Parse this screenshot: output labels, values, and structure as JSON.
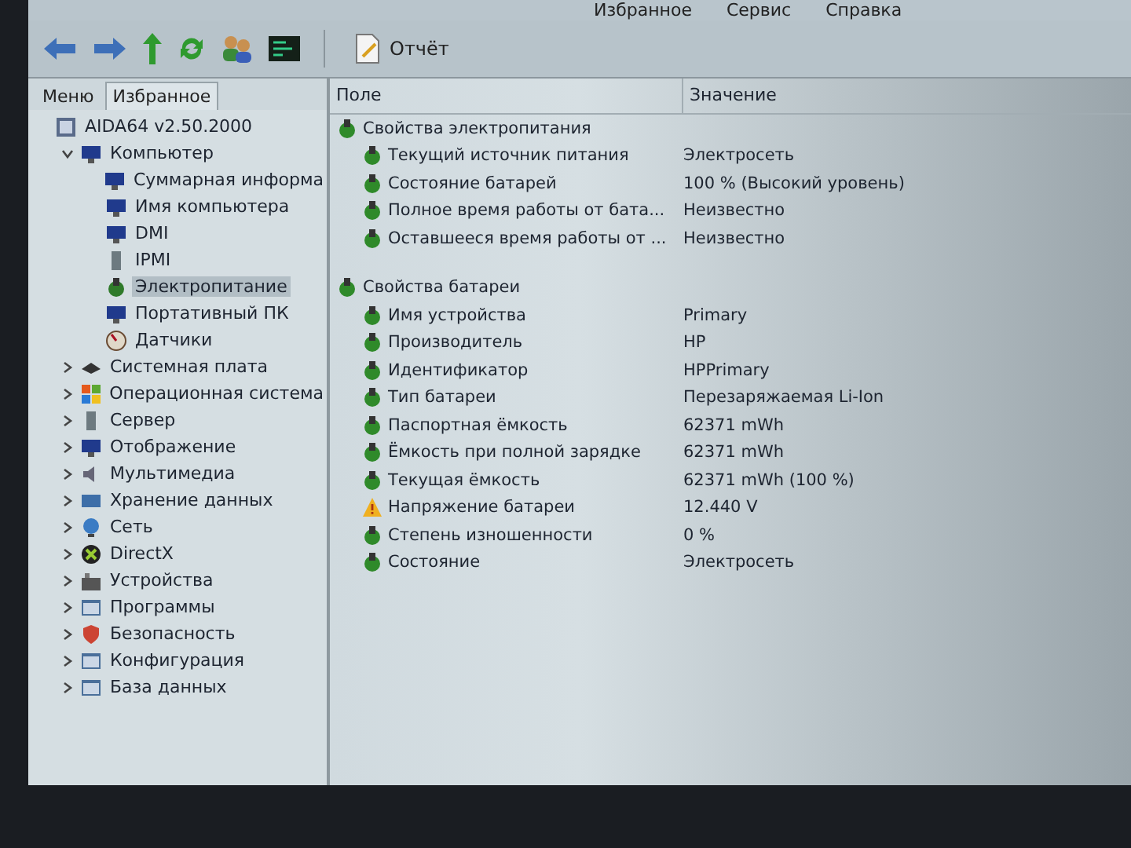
{
  "menu": [
    "Избранное",
    "Сервис",
    "Справка"
  ],
  "toolbar": {
    "report_button": "Отчёт"
  },
  "sidebar": {
    "tabs": [
      {
        "label": "Меню",
        "selected": false
      },
      {
        "label": "Избранное",
        "selected": true
      }
    ],
    "tree": [
      {
        "label": "AIDA64 v2.50.2000",
        "kind": "app",
        "selected": false,
        "children": [
          {
            "label": "Компьютер",
            "kind": "monitor",
            "expanded": true,
            "selected": false,
            "children": [
              {
                "label": "Суммарная информа",
                "kind": "monitor",
                "selected": false
              },
              {
                "label": "Имя компьютера",
                "kind": "monitor",
                "selected": false
              },
              {
                "label": "DMI",
                "kind": "monitor",
                "selected": false
              },
              {
                "label": "IPMI",
                "kind": "server",
                "selected": false
              },
              {
                "label": "Электропитание",
                "kind": "power",
                "selected": true
              },
              {
                "label": "Портативный ПК",
                "kind": "monitor",
                "selected": false
              },
              {
                "label": "Датчики",
                "kind": "gauge",
                "selected": false
              }
            ]
          },
          {
            "label": "Системная плата",
            "kind": "board",
            "expanded": false,
            "selected": false
          },
          {
            "label": "Операционная система",
            "kind": "windows",
            "expanded": false,
            "selected": false
          },
          {
            "label": "Сервер",
            "kind": "server",
            "expanded": false,
            "selected": false
          },
          {
            "label": "Отображение",
            "kind": "monitor",
            "expanded": false,
            "selected": false
          },
          {
            "label": "Мультимедиа",
            "kind": "speaker",
            "expanded": false,
            "selected": false
          },
          {
            "label": "Хранение данных",
            "kind": "disk",
            "expanded": false,
            "selected": false
          },
          {
            "label": "Сеть",
            "kind": "network",
            "expanded": false,
            "selected": false
          },
          {
            "label": "DirectX",
            "kind": "xbox",
            "expanded": false,
            "selected": false
          },
          {
            "label": "Устройства",
            "kind": "devices",
            "expanded": false,
            "selected": false
          },
          {
            "label": "Программы",
            "kind": "window",
            "expanded": false,
            "selected": false
          },
          {
            "label": "Безопасность",
            "kind": "shield",
            "expanded": false,
            "selected": false
          },
          {
            "label": "Конфигурация",
            "kind": "window",
            "expanded": false,
            "selected": false
          },
          {
            "label": "База данных",
            "kind": "window",
            "expanded": false,
            "selected": false
          }
        ]
      }
    ]
  },
  "table": {
    "columns": [
      "Поле",
      "Значение"
    ],
    "groups": [
      {
        "title": "Свойства электропитания",
        "rows": [
          {
            "field": "Текущий источник питания",
            "value": "Электросеть",
            "kind": "info"
          },
          {
            "field": "Состояние батарей",
            "value": "100 % (Высокий уровень)",
            "kind": "info"
          },
          {
            "field": "Полное время работы от бата...",
            "value": "Неизвестно",
            "kind": "info"
          },
          {
            "field": "Оставшееся время работы от ...",
            "value": "Неизвестно",
            "kind": "info"
          }
        ]
      },
      {
        "title": "Свойства батареи",
        "rows": [
          {
            "field": "Имя устройства",
            "value": "Primary",
            "kind": "info"
          },
          {
            "field": "Производитель",
            "value": "HP",
            "kind": "info"
          },
          {
            "field": "Идентификатор",
            "value": "HPPrimary",
            "kind": "info"
          },
          {
            "field": "Тип батареи",
            "value": "Перезаряжаемая Li-Ion",
            "kind": "info"
          },
          {
            "field": "Паспортная ёмкость",
            "value": "62371 mWh",
            "kind": "info"
          },
          {
            "field": "Ёмкость при полной зарядке",
            "value": "62371 mWh",
            "kind": "info"
          },
          {
            "field": "Текущая ёмкость",
            "value": "62371 mWh  (100 %)",
            "kind": "info"
          },
          {
            "field": "Напряжение батареи",
            "value": "12.440 V",
            "kind": "warning"
          },
          {
            "field": "Степень изношенности",
            "value": "0 %",
            "kind": "info"
          },
          {
            "field": "Состояние",
            "value": "Электросеть",
            "kind": "info"
          }
        ]
      }
    ]
  }
}
